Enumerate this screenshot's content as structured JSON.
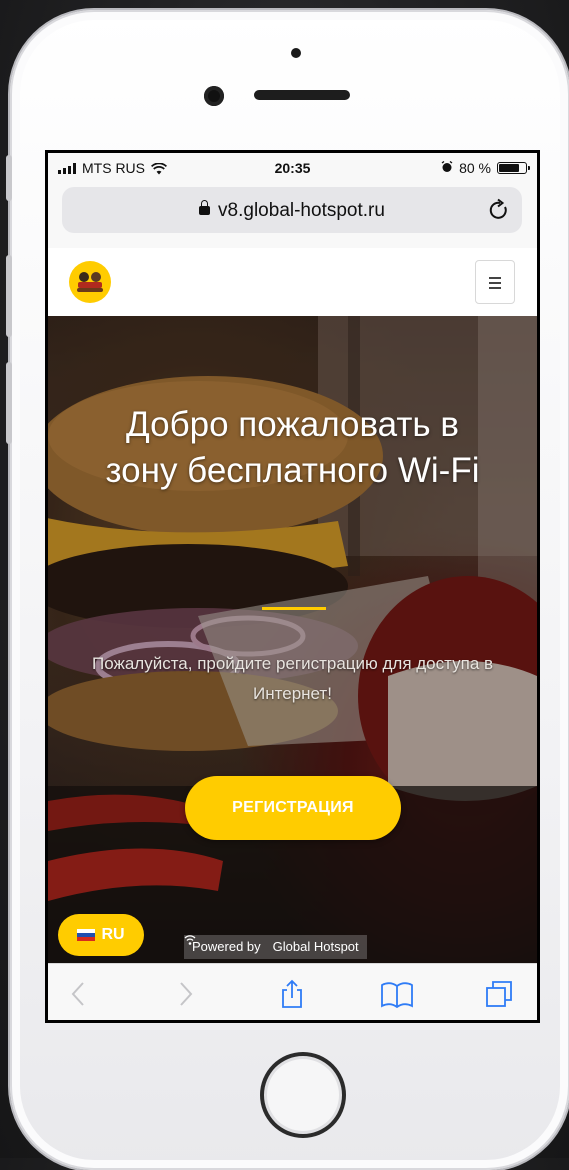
{
  "status_bar": {
    "carrier": "MTS RUS",
    "time": "20:35",
    "battery_text": "80 %",
    "battery_level": 0.8
  },
  "browser": {
    "url": "v8.global-hotspot.ru"
  },
  "hero": {
    "title": "Добро пожаловать в зону бесплатного Wi-Fi",
    "subtitle": "Пожалуйста, пройдите регистрацию для доступа в Интернет!",
    "register_button": "РЕГИСТРАЦИЯ",
    "language_button": "RU",
    "powered_by": "Powered by",
    "powered_brand": "Global Hotspot"
  },
  "colors": {
    "accent": "#ffcc00"
  }
}
